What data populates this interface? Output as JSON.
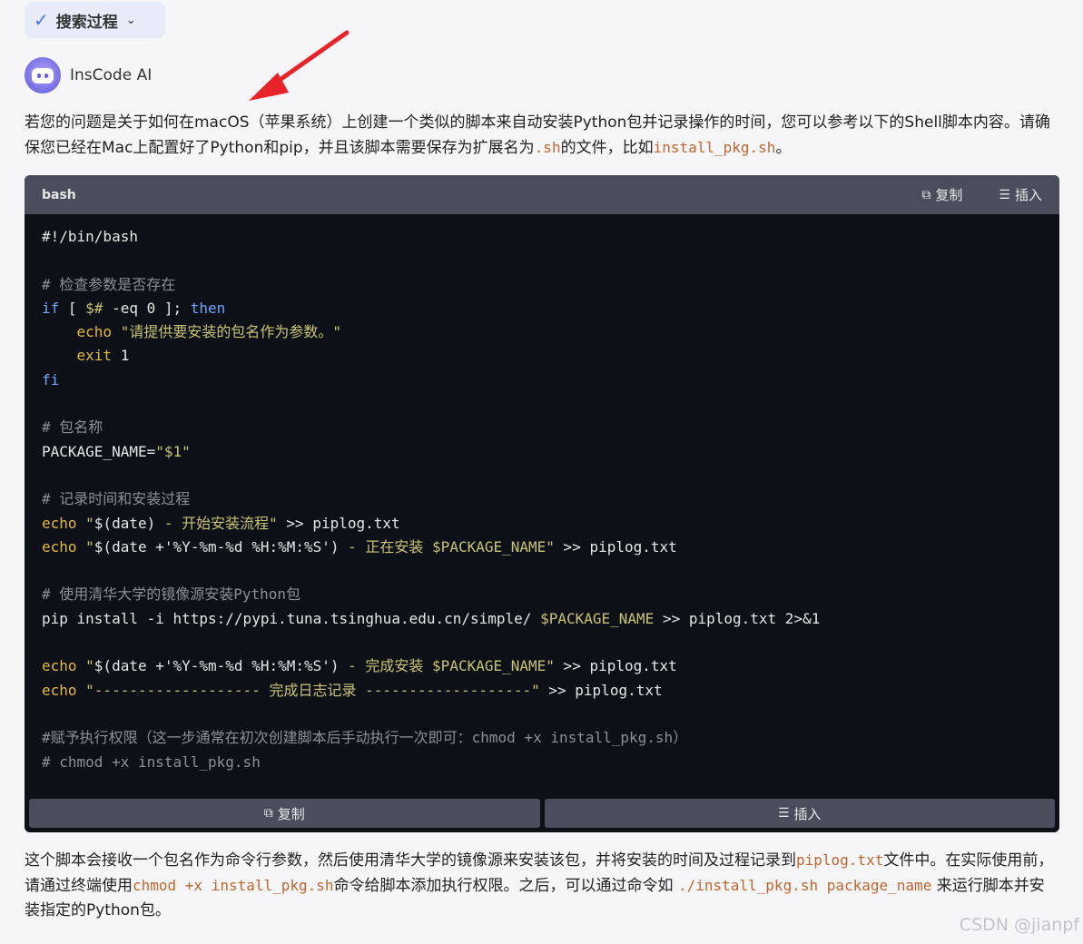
{
  "search_pill": {
    "label": "搜索过程"
  },
  "bot": {
    "name": "InsCode AI"
  },
  "para1": {
    "t1": "若您的问题是关于如何在macOS（苹果系统）上创建一个类似的脚本来自动安装Python包并记录操作的时间，您可以参考以下的Shell脚本内容。请确保您已经在Mac上配置好了Python和pip，并且该脚本需要保存为扩展名为",
    "code1": ".sh",
    "t2": "的文件，比如",
    "code2": "install_pkg.sh",
    "t3": "。"
  },
  "code_block": {
    "lang": "bash",
    "copy_label": "复制",
    "insert_label": "插入",
    "footer_copy_label": "复制",
    "footer_insert_label": "插入",
    "lines": {
      "l01": "#!/bin/bash",
      "l03": "# 检查参数是否存在",
      "l04a": "if",
      "l04b": " [ ",
      "l04c": "$#",
      "l04d": " -eq 0 ]; ",
      "l04e": "then",
      "l05a": "    echo",
      "l05b": " \"请提供要安装的包名作为参数。\"",
      "l06a": "    exit",
      "l06b": " 1",
      "l07": "fi",
      "l09": "# 包名称",
      "l10a": "PACKAGE_NAME=",
      "l10b": "\"$1\"",
      "l12": "# 记录时间和安装过程",
      "l13a": "echo",
      "l13b": " \"",
      "l13c": "$(date)",
      "l13d": " - 开始安装流程\"",
      "l13e": " >> piplog.txt",
      "l14a": "echo",
      "l14b": " \"",
      "l14c": "$(date +'%Y-%m-%d %H:%M:%S')",
      "l14d": " - 正在安装 $PACKAGE_NAME\"",
      "l14e": " >> piplog.txt",
      "l16": "# 使用清华大学的镜像源安装Python包",
      "l17a": "pip install -i https://pypi.tuna.tsinghua.edu.cn/simple/ ",
      "l17b": "$PACKAGE_NAME",
      "l17c": " >> piplog.txt 2>&1",
      "l19a": "echo",
      "l19b": " \"",
      "l19c": "$(date +'%Y-%m-%d %H:%M:%S')",
      "l19d": " - 完成安装 $PACKAGE_NAME\"",
      "l19e": " >> piplog.txt",
      "l20a": "echo",
      "l20b": " \"------------------- 完成日志记录 -------------------\"",
      "l20c": " >> piplog.txt",
      "l22": "#赋予执行权限（这一步通常在初次创建脚本后手动执行一次即可：chmod +x install_pkg.sh）",
      "l23": "# chmod +x install_pkg.sh"
    }
  },
  "para2": {
    "t1": "这个脚本会接收一个包名作为命令行参数，然后使用清华大学的镜像源来安装该包，并将安装的时间及过程记录到",
    "code1": "piplog.txt",
    "t2": "文件中。在实际使用前，请通过终端使用",
    "code2": "chmod +x install_pkg.sh",
    "t3": "命令给脚本添加执行权限。之后，可以通过命令如 ",
    "code3": "./install_pkg.sh package_name",
    "t4": " 来运行脚本并安装指定的Python包。"
  },
  "watermark": "CSDN @jianpf",
  "colors": {
    "arrow": "#e8232a",
    "accent": "#4a6cf7"
  }
}
